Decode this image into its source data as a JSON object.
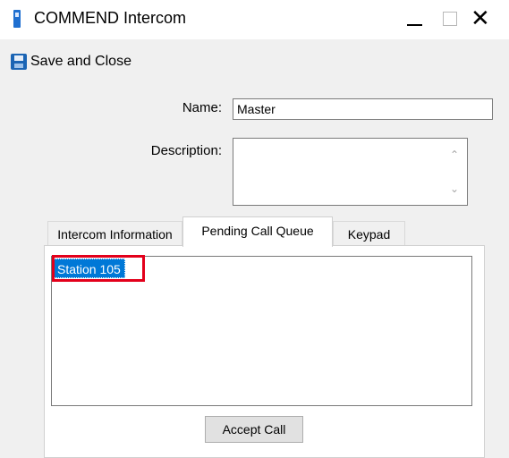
{
  "window": {
    "title": "COMMEND Intercom",
    "minimize_glyph": "—",
    "maximize_glyph": "☐",
    "close_glyph": "✕"
  },
  "toolbar": {
    "save_close_label": "Save and Close",
    "save_icon": "floppy-disk-icon"
  },
  "form": {
    "name_label": "Name:",
    "name_value": "Master",
    "description_label": "Description:",
    "description_value": ""
  },
  "tabs": [
    {
      "label": "Intercom Information",
      "selected": false
    },
    {
      "label": "Pending Call Queue",
      "selected": true
    },
    {
      "label": "Keypad",
      "selected": false
    }
  ],
  "pending_queue": {
    "items": [
      {
        "label": "Station 105",
        "selected": true
      }
    ],
    "accept_label": "Accept Call"
  },
  "colors": {
    "selection": "#0078d7",
    "highlight_annotation": "#e3001b"
  }
}
